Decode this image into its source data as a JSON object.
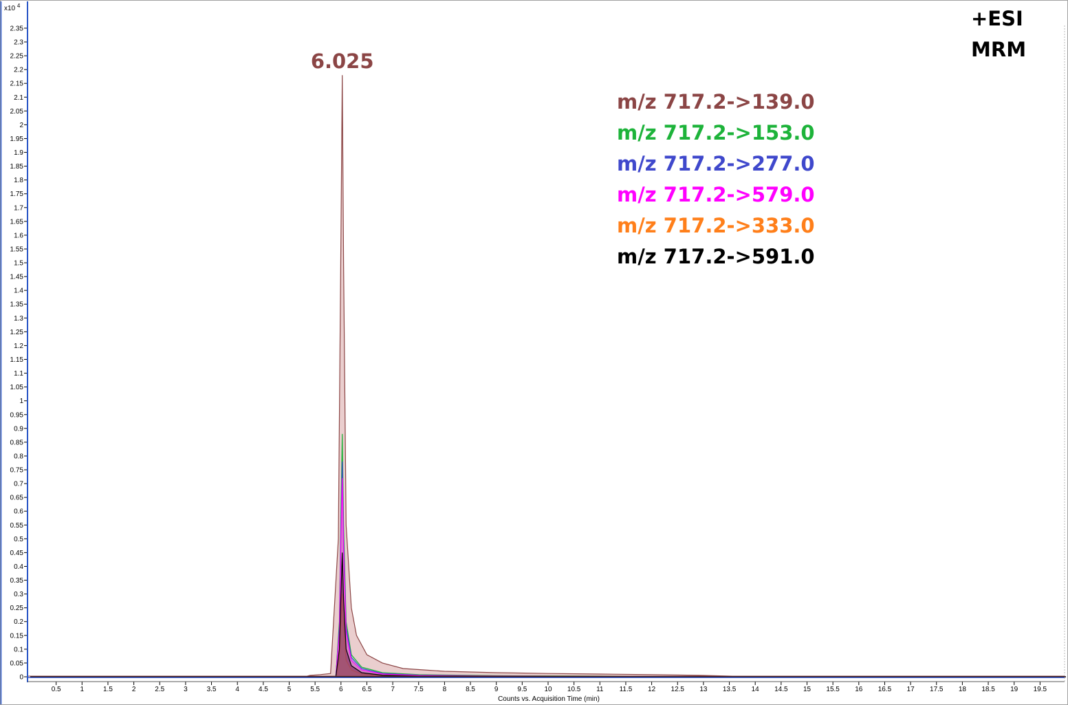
{
  "chart_data": {
    "type": "line",
    "title": "",
    "xlabel": "Counts vs. Acquisition Time (min)",
    "ylabel": "",
    "y_multiplier": "x10",
    "y_exponent": "4",
    "xlim": [
      0,
      20
    ],
    "ylim": [
      0,
      2.35
    ],
    "x_ticks": [
      0.5,
      1,
      1.5,
      2,
      2.5,
      3,
      3.5,
      4,
      4.5,
      5,
      5.5,
      6,
      6.5,
      7,
      7.5,
      8,
      8.5,
      9,
      9.5,
      10,
      10.5,
      11,
      11.5,
      12,
      12.5,
      13,
      13.5,
      14,
      14.5,
      15,
      15.5,
      16,
      16.5,
      17,
      17.5,
      18,
      18.5,
      19,
      19.5
    ],
    "y_ticks": [
      0,
      0.05,
      0.1,
      0.15,
      0.2,
      0.25,
      0.3,
      0.35,
      0.4,
      0.45,
      0.5,
      0.55,
      0.6,
      0.65,
      0.7,
      0.75,
      0.8,
      0.85,
      0.9,
      0.95,
      1,
      1.05,
      1.1,
      1.15,
      1.2,
      1.25,
      1.3,
      1.35,
      1.4,
      1.45,
      1.5,
      1.55,
      1.6,
      1.65,
      1.7,
      1.75,
      1.8,
      1.85,
      1.9,
      1.95,
      2,
      2.05,
      2.1,
      2.15,
      2.2,
      2.25,
      2.3,
      2.35
    ],
    "grid": false,
    "legend_position": "top-right",
    "annotations": [
      {
        "text": "6.025",
        "x": 6.025,
        "y": 2.18,
        "color": "#8B4545"
      },
      {
        "text": "+ESI",
        "position": "top-right"
      },
      {
        "text": "MRM",
        "position": "top-right"
      }
    ],
    "peak_retention_time": 6.025,
    "baseline_color": "#1f3fbf",
    "series": [
      {
        "name": "m/z 717.2->139.0",
        "color": "#8B4545",
        "fill": "#d9a6a6",
        "peak": 2.18,
        "x": [
          0,
          5.3,
          5.4,
          5.6,
          5.8,
          5.95,
          6.0,
          6.025,
          6.05,
          6.1,
          6.2,
          6.3,
          6.5,
          6.8,
          7.2,
          7.6,
          8.0,
          9.0,
          10.0,
          11.0,
          12.0,
          13.0,
          14.0,
          20.0
        ],
        "y": [
          0,
          0,
          0.005,
          0.008,
          0.012,
          0.5,
          1.6,
          2.18,
          1.5,
          0.55,
          0.25,
          0.15,
          0.08,
          0.05,
          0.03,
          0.025,
          0.02,
          0.015,
          0.012,
          0.01,
          0.008,
          0.005,
          0,
          0
        ]
      },
      {
        "name": "m/z 717.2->153.0",
        "color": "#1db33a",
        "fill": "#a9d9a9",
        "peak": 0.88,
        "x": [
          0,
          5.9,
          5.97,
          6.0,
          6.025,
          6.05,
          6.1,
          6.2,
          6.4,
          6.8,
          7.5,
          9.0,
          12.0,
          20.0
        ],
        "y": [
          0,
          0,
          0.2,
          0.6,
          0.88,
          0.55,
          0.2,
          0.08,
          0.035,
          0.015,
          0.008,
          0.004,
          0.002,
          0
        ]
      },
      {
        "name": "m/z 717.2->277.0",
        "color": "#3f48cc",
        "fill": "#a8b0e0",
        "peak": 0.78,
        "x": [
          0,
          5.9,
          5.97,
          6.0,
          6.025,
          6.05,
          6.1,
          6.2,
          6.4,
          6.8,
          7.5,
          9.0,
          12.0,
          20.0
        ],
        "y": [
          0,
          0,
          0.18,
          0.55,
          0.78,
          0.5,
          0.18,
          0.07,
          0.03,
          0.012,
          0.006,
          0.003,
          0.001,
          0
        ]
      },
      {
        "name": "m/z 717.2->579.0",
        "color": "#ff00ff",
        "fill": "#e070c0",
        "peak": 0.72,
        "x": [
          0,
          5.9,
          5.97,
          6.0,
          6.025,
          6.05,
          6.1,
          6.2,
          6.4,
          6.8,
          7.5,
          9.0,
          12.0,
          20.0
        ],
        "y": [
          0,
          0,
          0.16,
          0.5,
          0.72,
          0.46,
          0.16,
          0.06,
          0.025,
          0.01,
          0.005,
          0.003,
          0.001,
          0
        ]
      },
      {
        "name": "m/z 717.2->333.0",
        "color": "#ff7f1a",
        "fill": "#f0b080",
        "peak": 0.3,
        "x": [
          0,
          5.9,
          5.97,
          6.0,
          6.025,
          6.05,
          6.1,
          6.2,
          6.4,
          6.8,
          7.5,
          20.0
        ],
        "y": [
          0,
          0,
          0.06,
          0.2,
          0.3,
          0.18,
          0.06,
          0.025,
          0.01,
          0.005,
          0.002,
          0
        ]
      },
      {
        "name": "m/z 717.2->591.0",
        "color": "#000000",
        "fill": "#8b3a6a",
        "peak": 0.45,
        "x": [
          0,
          5.9,
          5.97,
          6.0,
          6.025,
          6.05,
          6.1,
          6.2,
          6.4,
          6.8,
          7.5,
          20.0
        ],
        "y": [
          0,
          0,
          0.1,
          0.3,
          0.45,
          0.28,
          0.1,
          0.04,
          0.015,
          0.006,
          0.003,
          0
        ]
      }
    ]
  }
}
